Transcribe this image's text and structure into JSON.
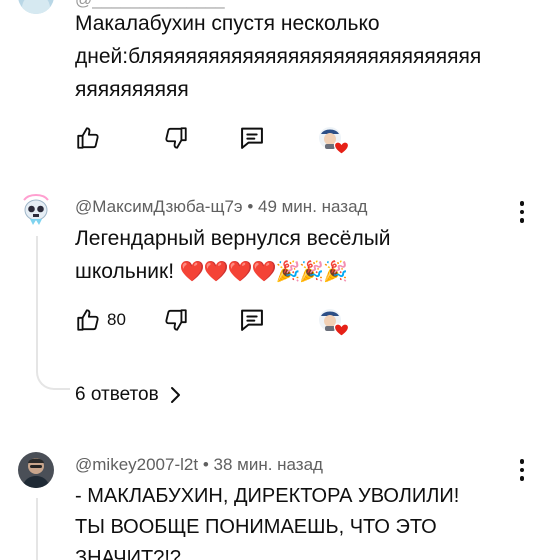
{
  "comments": [
    {
      "handle_partial": "@______________",
      "text_lines": [
        "Макалабухин спустя несколько",
        "дней:бляяяяяяяяяяяяяяяяяяяяяяяяяяяяя",
        "яяяяяяяяяя"
      ],
      "likes": ""
    },
    {
      "handle": "@МаксимДзюба-щ7э",
      "time": "• 49 мин. назад",
      "text_lines": [
        "Легендарный вернулся весёлый",
        "школьник!"
      ],
      "emoji": "❤️❤️❤️❤️🎉🎉🎉",
      "likes": "80",
      "replies_label": "6 ответов"
    },
    {
      "handle": "@mikey2007-l2t",
      "time": "• 38 мин. назад",
      "text_lines": [
        "- МАКЛАБУХИН, ДИРЕКТОРА УВОЛИЛИ!",
        "ТЫ ВООБЩЕ ПОНИМАЕШЬ, ЧТО ЭТО",
        "ЗНАЧИТ?!?"
      ]
    }
  ],
  "icons": {
    "like": "thumbs-up-icon",
    "dislike": "thumbs-down-icon",
    "reply": "reply-comment-icon",
    "creator_heart": "creator-heart-icon",
    "more": "more-vertical-icon",
    "chevron": "chevron-right-icon"
  },
  "colors": {
    "heart": "#e62117",
    "meta_text": "#606060"
  }
}
